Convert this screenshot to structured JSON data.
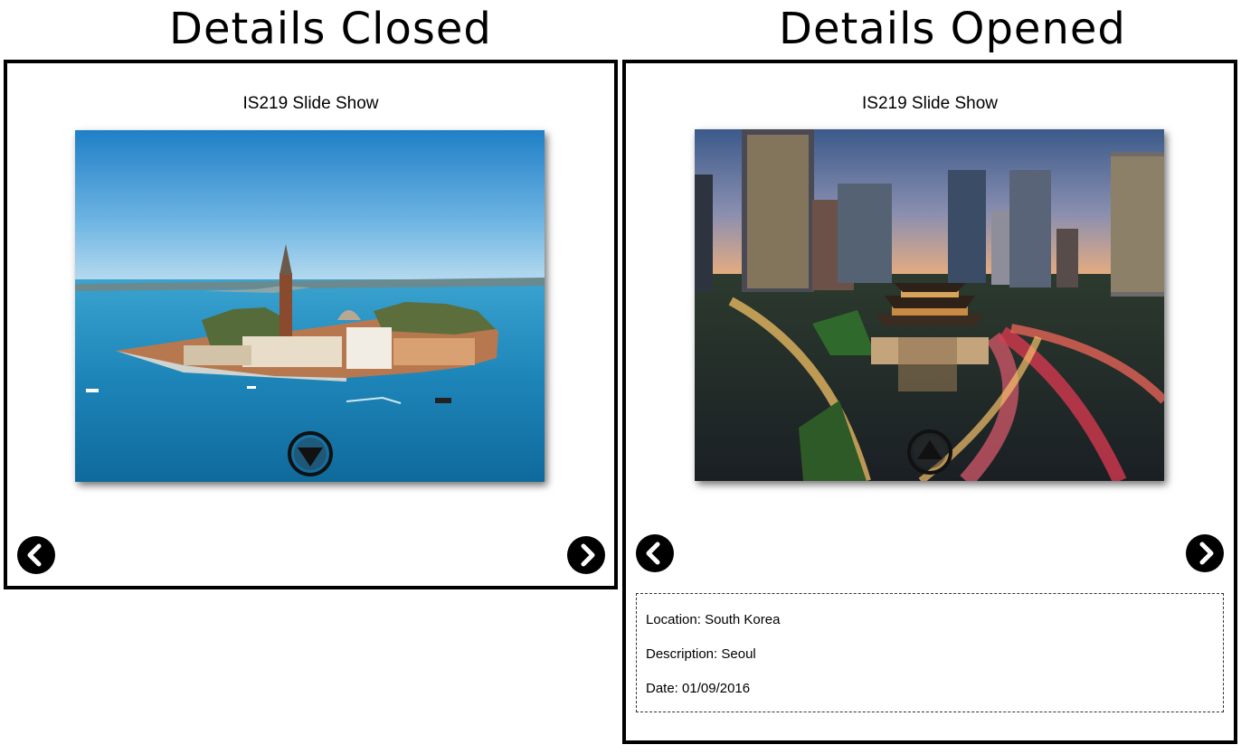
{
  "labels": {
    "closed_heading": "Details Closed",
    "opened_heading": "Details Opened"
  },
  "closed_view": {
    "slideshow_title": "IS219 Slide Show",
    "photo_subject": "Venice island with bell tower",
    "toggle_icon": "chevron-down-circle-icon",
    "prev_icon": "chevron-left-icon",
    "next_icon": "chevron-right-icon"
  },
  "opened_view": {
    "slideshow_title": "IS219 Slide Show",
    "photo_subject": "Seoul city gate at dusk",
    "toggle_icon": "chevron-up-circle-icon",
    "prev_icon": "chevron-left-icon",
    "next_icon": "chevron-right-icon",
    "details": {
      "location_label": "Location:",
      "location_value": "South Korea",
      "description_label": "Description:",
      "description_value": "Seoul",
      "date_label": "Date:",
      "date_value": "01/09/2016"
    }
  },
  "colors": {
    "border": "#000000",
    "nav_button": "#000000",
    "background": "#ffffff"
  }
}
